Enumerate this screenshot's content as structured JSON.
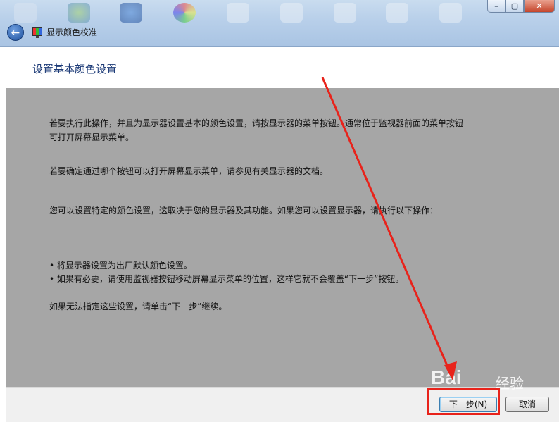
{
  "window": {
    "title": "显示颜色校准",
    "controls": {
      "minimize": "–",
      "maximize": "▢",
      "close": "✕"
    },
    "back_icon": "back-arrow-icon",
    "accent": "#1e3c78"
  },
  "page": {
    "title": "设置基本颜色设置",
    "paragraphs": [
      "若要执行此操作，并且为显示器设置基本的颜色设置，请按显示器的菜单按钮。通常位于监视器前面的菜单按钮",
      "可打开屏幕显示菜单。",
      "若要确定通过哪个按钮可以打开屏幕显示菜单，请参见有关显示器的文档。",
      "您可以设置特定的颜色设置，这取决于您的显示器及其功能。如果您可以设置显示器，请执行以下操作：",
      "如果无法指定这些设置，请单击“下一步”继续。"
    ],
    "bullets": [
      "• 将显示器设置为出厂默认颜色设置。",
      "• 如果有必要，请使用监视器按钮移动屏幕显示菜单的位置，这样它就不会覆盖“下一步”按钮。"
    ]
  },
  "footer": {
    "next_label": "下一步(N)",
    "cancel_label": "取消"
  },
  "annotation": {
    "color": "#e8231b"
  },
  "watermark": {
    "text": "Bai",
    "sub": "经验"
  }
}
